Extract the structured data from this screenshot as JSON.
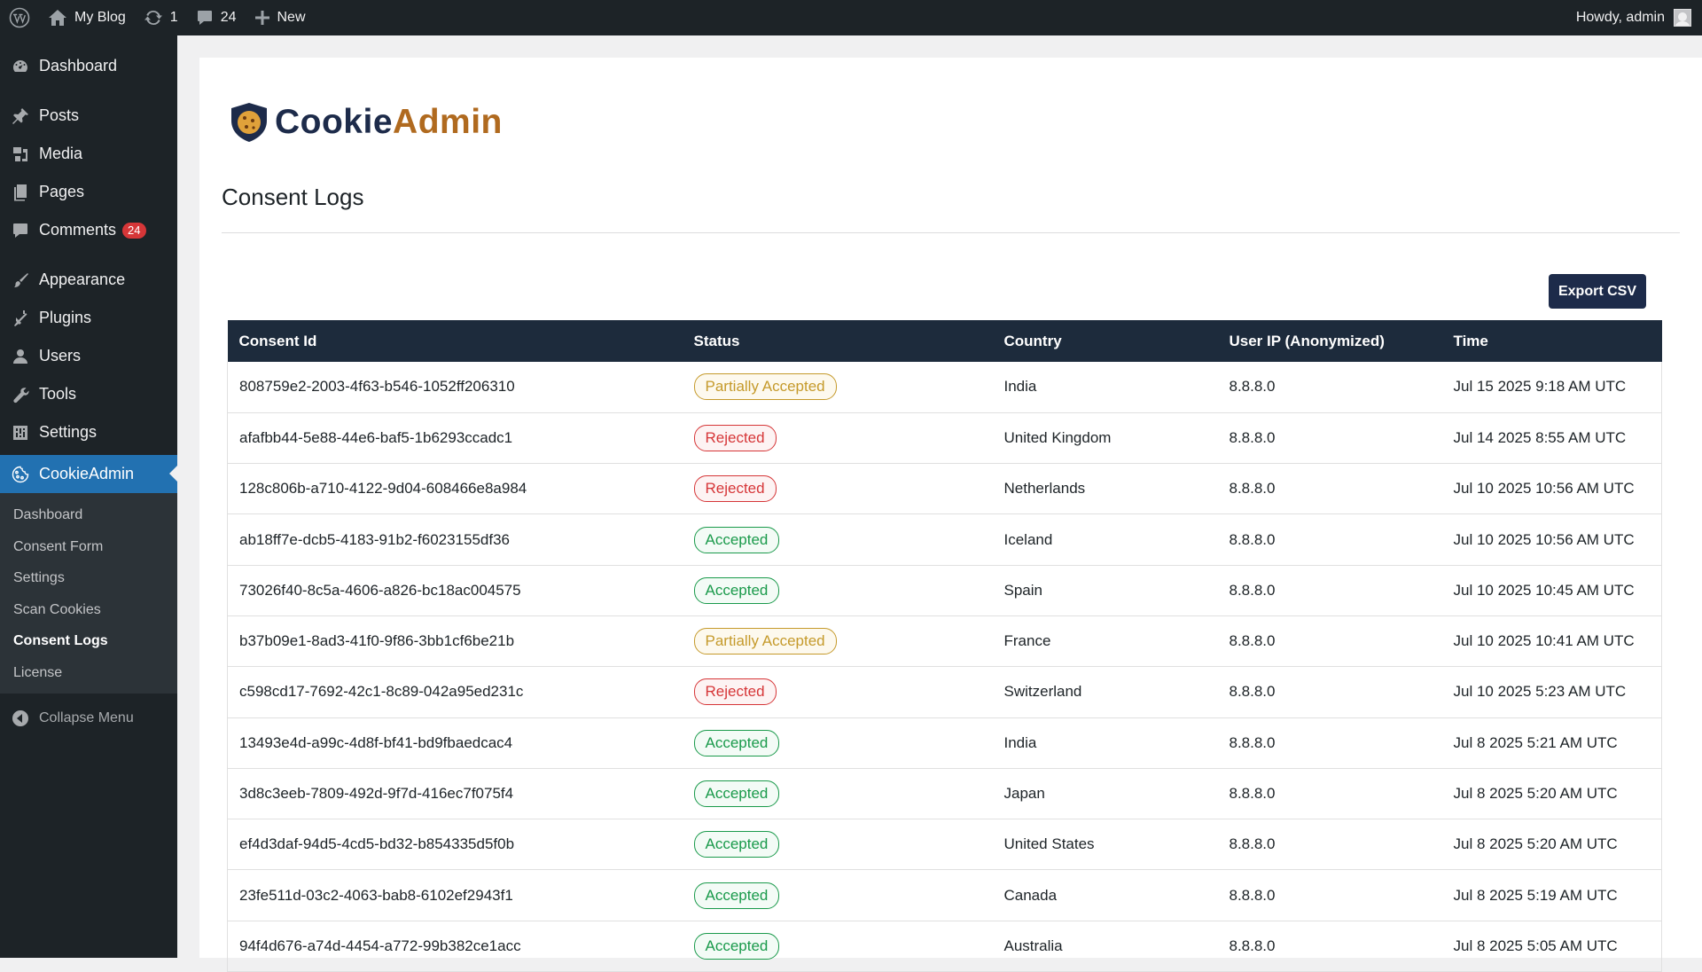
{
  "adminbar": {
    "site_name": "My Blog",
    "updates_count": "1",
    "comments_count": "24",
    "new_label": "New",
    "howdy": "Howdy, admin"
  },
  "sidebar": {
    "items": [
      {
        "label": "Dashboard",
        "icon": "dashboard-icon"
      },
      {
        "label": "Posts",
        "icon": "pin-icon"
      },
      {
        "label": "Media",
        "icon": "media-icon"
      },
      {
        "label": "Pages",
        "icon": "pages-icon"
      },
      {
        "label": "Comments",
        "icon": "comment-icon",
        "badge": "24"
      },
      {
        "label": "Appearance",
        "icon": "brush-icon"
      },
      {
        "label": "Plugins",
        "icon": "plugin-icon"
      },
      {
        "label": "Users",
        "icon": "user-icon"
      },
      {
        "label": "Tools",
        "icon": "wrench-icon"
      },
      {
        "label": "Settings",
        "icon": "settings-icon"
      },
      {
        "label": "CookieAdmin",
        "icon": "cookie-icon"
      }
    ],
    "submenu": [
      "Dashboard",
      "Consent Form",
      "Settings",
      "Scan Cookies",
      "Consent Logs",
      "License"
    ],
    "collapse_label": "Collapse Menu"
  },
  "brand": {
    "part1": "Cookie",
    "part2": "Admin"
  },
  "page": {
    "title": "Consent Logs",
    "export_label": "Export CSV"
  },
  "table": {
    "headers": [
      "Consent Id",
      "Status",
      "Country",
      "User IP (Anonymized)",
      "Time"
    ],
    "rows": [
      {
        "id": "808759e2-2003-4f63-b546-1052ff206310",
        "status": "Partially Accepted",
        "kind": "partial",
        "country": "India",
        "ip": "8.8.8.0",
        "time": "Jul 15 2025 9:18 AM UTC"
      },
      {
        "id": "afafbb44-5e88-44e6-baf5-1b6293ccadc1",
        "status": "Rejected",
        "kind": "rejected",
        "country": "United Kingdom",
        "ip": "8.8.8.0",
        "time": "Jul 14 2025 8:55 AM UTC"
      },
      {
        "id": "128c806b-a710-4122-9d04-608466e8a984",
        "status": "Rejected",
        "kind": "rejected",
        "country": "Netherlands",
        "ip": "8.8.8.0",
        "time": "Jul 10 2025 10:56 AM UTC"
      },
      {
        "id": "ab18ff7e-dcb5-4183-91b2-f6023155df36",
        "status": "Accepted",
        "kind": "accepted",
        "country": "Iceland",
        "ip": "8.8.8.0",
        "time": "Jul 10 2025 10:56 AM UTC"
      },
      {
        "id": "73026f40-8c5a-4606-a826-bc18ac004575",
        "status": "Accepted",
        "kind": "accepted",
        "country": "Spain",
        "ip": "8.8.8.0",
        "time": "Jul 10 2025 10:45 AM UTC"
      },
      {
        "id": "b37b09e1-8ad3-41f0-9f86-3bb1cf6be21b",
        "status": "Partially Accepted",
        "kind": "partial",
        "country": "France",
        "ip": "8.8.8.0",
        "time": "Jul 10 2025 10:41 AM UTC"
      },
      {
        "id": "c598cd17-7692-42c1-8c89-042a95ed231c",
        "status": "Rejected",
        "kind": "rejected",
        "country": "Switzerland",
        "ip": "8.8.8.0",
        "time": "Jul 10 2025 5:23 AM UTC"
      },
      {
        "id": "13493e4d-a99c-4d8f-bf41-bd9fbaedcac4",
        "status": "Accepted",
        "kind": "accepted",
        "country": "India",
        "ip": "8.8.8.0",
        "time": "Jul 8 2025 5:21 AM UTC"
      },
      {
        "id": "3d8c3eeb-7809-492d-9f7d-416ec7f075f4",
        "status": "Accepted",
        "kind": "accepted",
        "country": "Japan",
        "ip": "8.8.8.0",
        "time": "Jul 8 2025 5:20 AM UTC"
      },
      {
        "id": "ef4d3daf-94d5-4cd5-bd32-b854335d5f0b",
        "status": "Accepted",
        "kind": "accepted",
        "country": "United States",
        "ip": "8.8.8.0",
        "time": "Jul 8 2025 5:20 AM UTC"
      },
      {
        "id": "23fe511d-03c2-4063-bab8-6102ef2943f1",
        "status": "Accepted",
        "kind": "accepted",
        "country": "Canada",
        "ip": "8.8.8.0",
        "time": "Jul 8 2025 5:19 AM UTC"
      },
      {
        "id": "94f4d676-a74d-4454-a772-99b382ce1acc",
        "status": "Accepted",
        "kind": "accepted",
        "country": "Australia",
        "ip": "8.8.8.0",
        "time": "Jul 8 2025 5:05 AM UTC"
      }
    ]
  },
  "colors": {
    "sidebar_bg": "#1d2327",
    "accent": "#2271b1",
    "table_header": "#1d2b3c",
    "accepted": "#1a9a4b",
    "rejected": "#d63638",
    "partial": "#c59a2b"
  }
}
